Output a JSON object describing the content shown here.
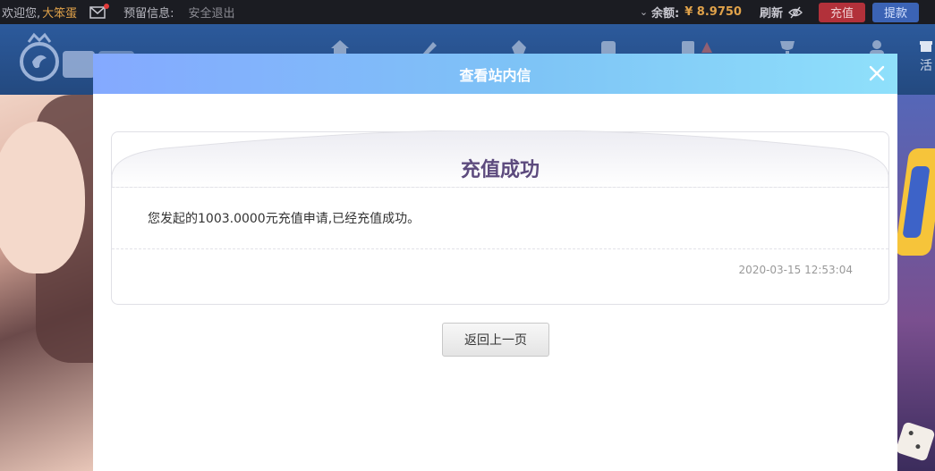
{
  "topbar": {
    "welcome": "欢迎您,",
    "username": "大笨蛋",
    "reserve_label": "预留信息:",
    "logout": "安全退出",
    "balance_label": "余额:",
    "balance_value": "¥ 8.9750",
    "refresh": "刷新",
    "recharge": "充值",
    "withdraw": "提款"
  },
  "nav": {
    "cut_label": "活"
  },
  "modal": {
    "title": "查看站内信",
    "message_title": "充值成功",
    "message_body": "您发起的1003.0000元充值申请,已经充值成功。",
    "timestamp": "2020-03-15 12:53:04",
    "back_button": "返回上一页"
  },
  "colors": {
    "accent_gold": "#e0a24a",
    "recharge_red": "#b2313a",
    "withdraw_blue": "#3b63b5",
    "message_title": "#5d4b7e"
  }
}
